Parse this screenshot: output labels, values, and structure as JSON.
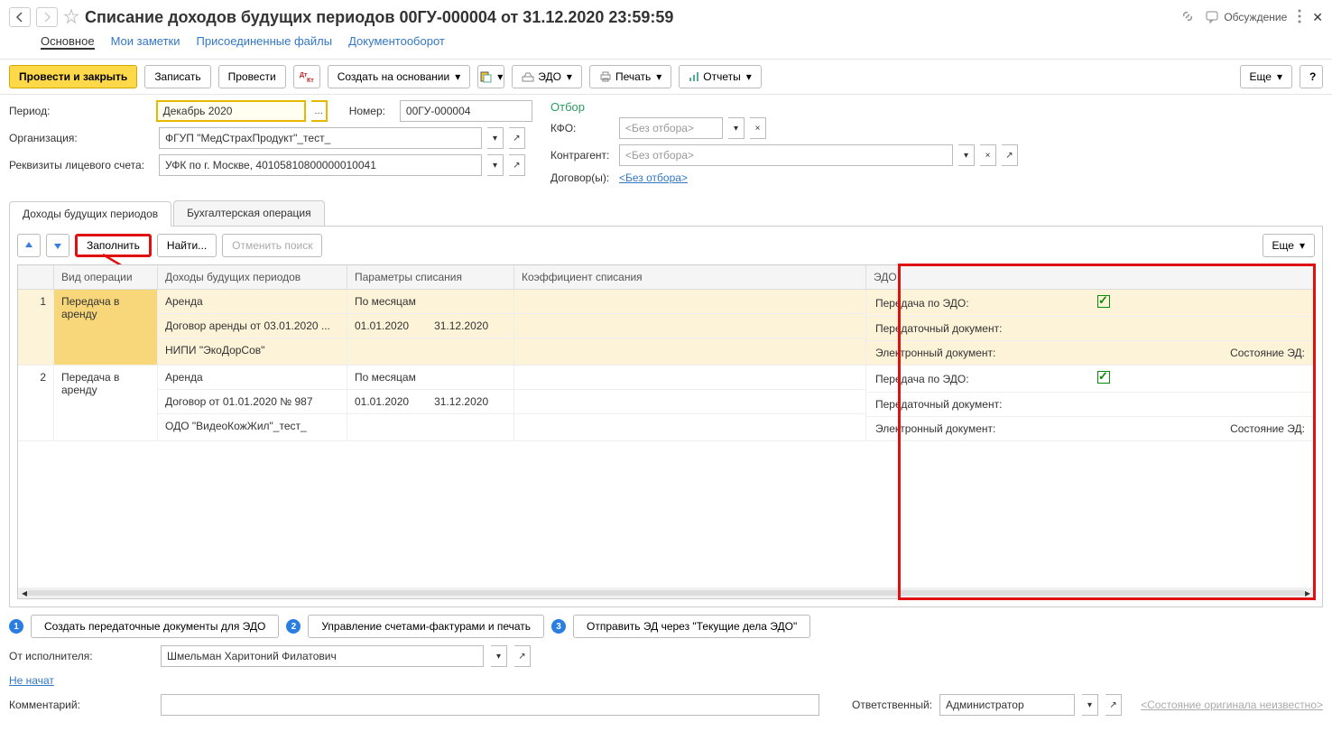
{
  "header": {
    "title": "Списание доходов будущих периодов 00ГУ-000004 от 31.12.2020 23:59:59",
    "discuss": "Обсуждение"
  },
  "subnav": {
    "main": "Основное",
    "notes": "Мои заметки",
    "files": "Присоединенные файлы",
    "docflow": "Документооборот"
  },
  "toolbar": {
    "post_close": "Провести и закрыть",
    "write": "Записать",
    "post": "Провести",
    "create_based": "Создать на основании",
    "edo": "ЭДО",
    "print": "Печать",
    "reports": "Отчеты",
    "more": "Еще",
    "help": "?"
  },
  "form": {
    "period_label": "Период:",
    "period_value": "Декабрь 2020",
    "number_label": "Номер:",
    "number_value": "00ГУ-000004",
    "org_label": "Организация:",
    "org_value": "ФГУП \"МедСтрахПродукт\"_тест_",
    "acc_label": "Реквизиты лицевого счета:",
    "acc_value": "УФК по г. Москве, 40105810800000010041",
    "filter_title": "Отбор",
    "kfo_label": "КФО:",
    "no_filter": "<Без отбора>",
    "counter_label": "Контрагент:",
    "contracts_label": "Договор(ы):",
    "contracts_link": "<Без отбора>"
  },
  "tabs": {
    "dbp": "Доходы будущих периодов",
    "acc_op": "Бухгалтерская операция"
  },
  "tab_toolbar": {
    "fill": "Заполнить",
    "find": "Найти...",
    "cancel_find": "Отменить поиск",
    "more": "Еще"
  },
  "grid": {
    "h_n": "",
    "h_op": "Вид операции",
    "h_dbp": "Доходы будущих периодов",
    "h_par": "Параметры списания",
    "h_coef": "Коэффициент списания",
    "h_edo": "ЭДО",
    "rows": [
      {
        "n": "1",
        "op": "Передача в аренду",
        "dbp1": "Аренда",
        "dbp2": "Договор аренды от 03.01.2020 ...",
        "dbp3": "НИПИ \"ЭкоДорСов\"",
        "par1": "По месяцам",
        "par2a": "01.01.2020",
        "par2b": "31.12.2020",
        "edo1": "Передача по ЭДО:",
        "edo2": "Передаточный документ:",
        "edo3": "Электронный документ:",
        "edo3b": "Состояние ЭД:"
      },
      {
        "n": "2",
        "op": "Передача в аренду",
        "dbp1": "Аренда",
        "dbp2": "Договор от 01.01.2020 № 987",
        "dbp3": "ОДО \"ВидеоКожЖил\"_тест_",
        "par1": "По месяцам",
        "par2a": "01.01.2020",
        "par2b": "31.12.2020",
        "edo1": "Передача по ЭДО:",
        "edo2": "Передаточный документ:",
        "edo3": "Электронный документ:",
        "edo3b": "Состояние ЭД:"
      }
    ]
  },
  "footer": {
    "b1": "Создать передаточные документы для ЭДО",
    "b2": "Управление счетами-фактурами и печать",
    "b3": "Отправить ЭД через \"Текущие дела ЭДО\"",
    "exec_label": "От исполнителя:",
    "exec_value": "Шмельман Харитоний Филатович",
    "not_started": "Не начат",
    "comment_label": "Комментарий:",
    "comment_value": "",
    "resp_label": "Ответственный:",
    "resp_value": "Администратор",
    "state_unknown": "<Состояние оригинала неизвестно>"
  }
}
